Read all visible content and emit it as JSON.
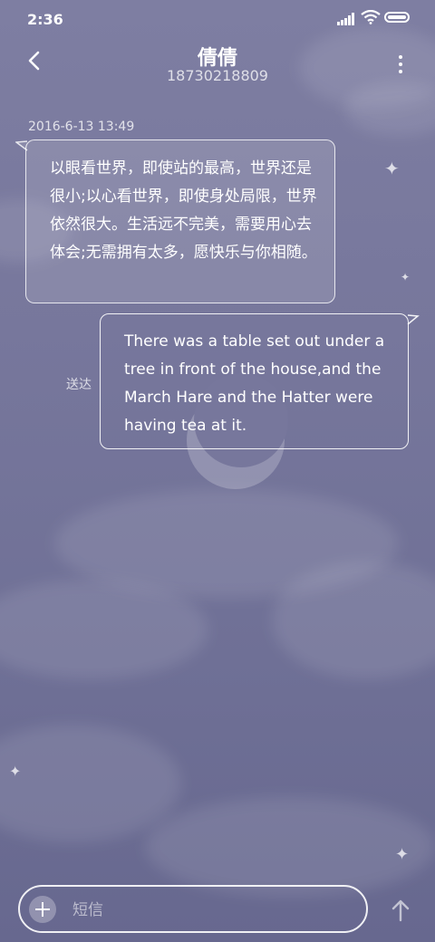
{
  "status_bar": {
    "time": "2:36",
    "icons": [
      "signal-icon",
      "wifi-icon",
      "battery-icon"
    ]
  },
  "header": {
    "contact_name": "倩倩",
    "phone_number": "18730218809",
    "back_icon": "chevron-left-icon",
    "more_icon": "vertical-dots-icon"
  },
  "conversation": {
    "timestamp": "2016-6-13 13:49",
    "messages": [
      {
        "direction": "incoming",
        "text": "以眼看世界，即使站的最高，世界还是很小;以心看世界，即使身处局限，世界依然很大。生活远不完美，需要用心去体会;无需拥有太多，愿快乐与你相随。"
      },
      {
        "direction": "outgoing",
        "text": "There was a table set out under a tree in front of the house,and the March Hare and the Hatter were having tea at it.",
        "status": "送达"
      }
    ]
  },
  "composer": {
    "placeholder": "短信",
    "value": "",
    "add_icon": "plus-icon",
    "send_icon": "arrow-up-icon"
  },
  "colors": {
    "background": "#77779c",
    "text": "#ffffff"
  }
}
